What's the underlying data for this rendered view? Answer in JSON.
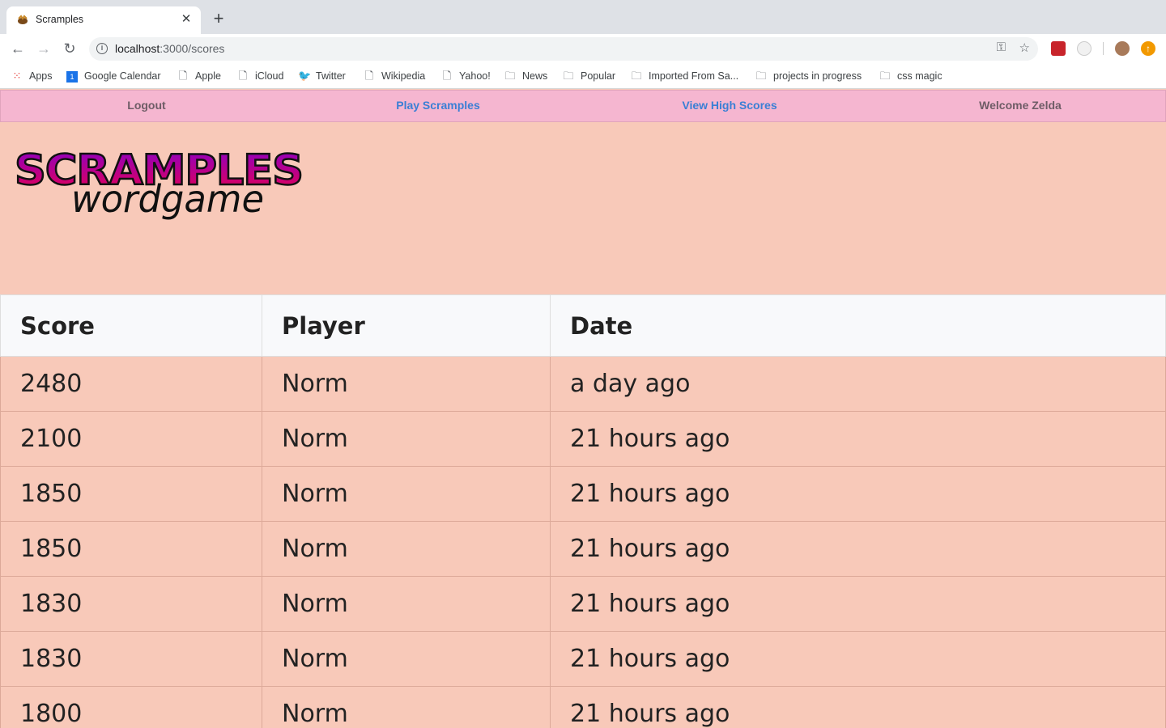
{
  "browser": {
    "tab_title": "Scramples",
    "url_host": "localhost",
    "url_path": ":3000/scores",
    "bookmarks": [
      {
        "label": "Apps",
        "icon": "apps-grid-icon"
      },
      {
        "label": "Google Calendar",
        "icon": "calendar-icon"
      },
      {
        "label": "Apple",
        "icon": "page-icon"
      },
      {
        "label": "iCloud",
        "icon": "page-icon"
      },
      {
        "label": "Twitter",
        "icon": "twitter-icon"
      },
      {
        "label": "Wikipedia",
        "icon": "page-icon"
      },
      {
        "label": "Yahoo!",
        "icon": "page-icon"
      },
      {
        "label": "News",
        "icon": "folder-icon"
      },
      {
        "label": "Popular",
        "icon": "folder-icon"
      },
      {
        "label": "Imported From Sa...",
        "icon": "folder-icon"
      },
      {
        "label": "projects in progress",
        "icon": "folder-icon"
      },
      {
        "label": "css magic",
        "icon": "folder-icon"
      }
    ]
  },
  "nav": {
    "logout": "Logout",
    "play": "Play Scramples",
    "high_scores": "View High Scores",
    "welcome": "Welcome Zelda"
  },
  "logo": {
    "title": "SCRAMPLES",
    "subtitle": "wordgame"
  },
  "table": {
    "headers": [
      "Score",
      "Player",
      "Date"
    ],
    "rows": [
      [
        "2480",
        "Norm",
        "a day ago"
      ],
      [
        "2100",
        "Norm",
        "21 hours ago"
      ],
      [
        "1850",
        "Norm",
        "21 hours ago"
      ],
      [
        "1850",
        "Norm",
        "21 hours ago"
      ],
      [
        "1830",
        "Norm",
        "21 hours ago"
      ],
      [
        "1830",
        "Norm",
        "21 hours ago"
      ],
      [
        "1800",
        "Norm",
        "21 hours ago"
      ]
    ]
  },
  "colors": {
    "page_bg": "#f8c9b9",
    "nav_bg": "#f5b6d0",
    "link_blue": "#3a7fd5",
    "logo_gradient_start": "#8a00c8",
    "logo_gradient_end": "#e8004e"
  }
}
